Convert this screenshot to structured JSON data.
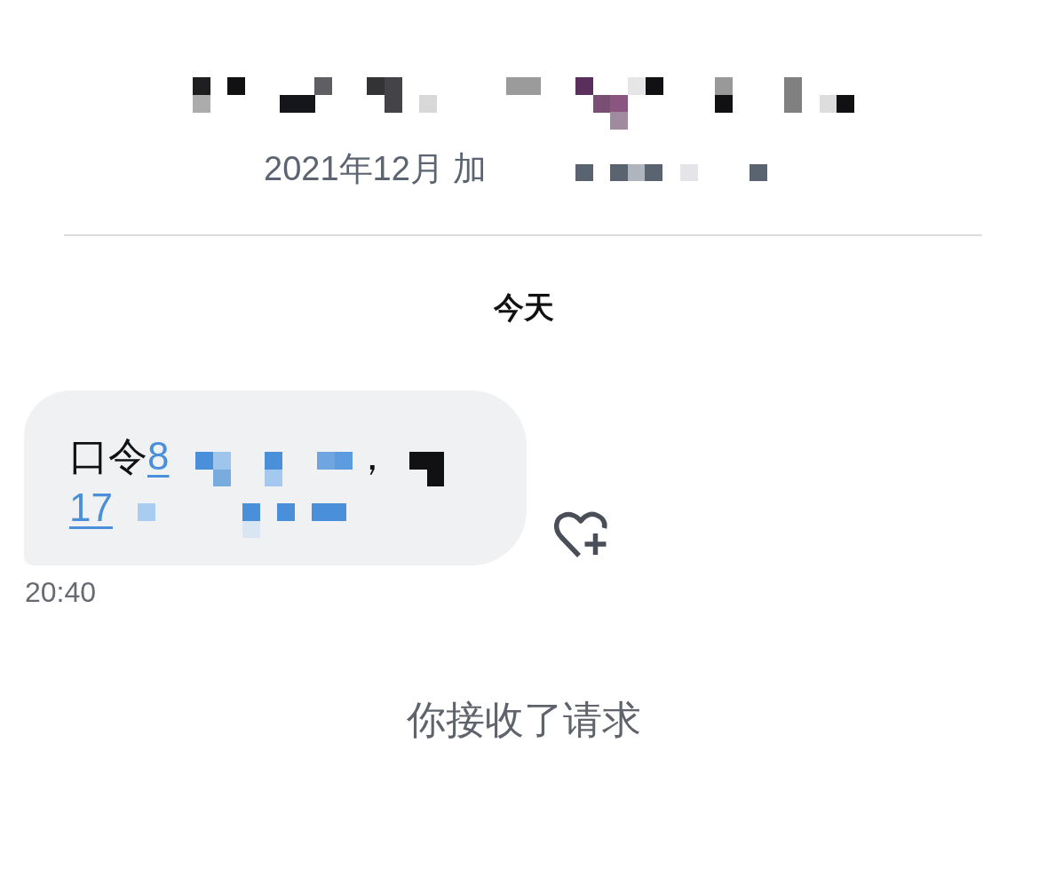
{
  "header": {
    "title": [
      {
        "kind": "redacted"
      }
    ],
    "subtitle": [
      {
        "kind": "text",
        "text": "2021年12月 加"
      },
      {
        "kind": "redacted"
      }
    ]
  },
  "date_separator": "今天",
  "message": {
    "lines": [
      [
        {
          "kind": "text",
          "text": "口令"
        },
        {
          "kind": "link",
          "text": "8"
        },
        {
          "kind": "redacted"
        },
        {
          "kind": "text",
          "text": "，"
        },
        {
          "kind": "redacted"
        }
      ],
      [
        {
          "kind": "link",
          "text": "17"
        },
        {
          "kind": "redacted"
        }
      ]
    ],
    "time": "20:40"
  },
  "system_notice": "你接收了请求"
}
